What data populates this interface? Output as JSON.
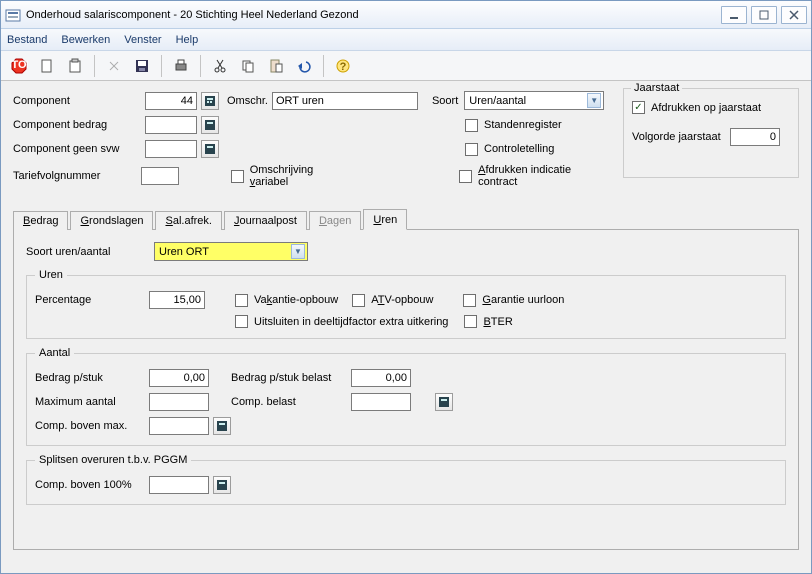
{
  "window": {
    "title": "Onderhoud salariscomponent - 20 Stichting Heel Nederland Gezond"
  },
  "menu": {
    "items": [
      "Bestand",
      "Bewerken",
      "Venster",
      "Help"
    ]
  },
  "form": {
    "component_label": "Component",
    "component_value": "44",
    "omschr_label": "Omschr.",
    "omschr_value": "ORT uren",
    "soort_label": "Soort",
    "soort_value": "Uren/aantal",
    "component_bedrag_label": "Component bedrag",
    "component_bedrag_value": "",
    "component_geen_svw_label": "Component geen svw",
    "component_geen_svw_value": "",
    "tariefvolg_label": "Tariefvolgnummer",
    "tariefvolg_value": "",
    "omschrijving_variabel": "Omschrijving variabel",
    "standenregister": "Standenregister",
    "controletelling": "Controletelling",
    "afdrukken_indicatie": "Afdrukken indicatie contract"
  },
  "jaar": {
    "legend": "Jaarstaat",
    "afdrukken": "Afdrukken op jaarstaat",
    "volgorde_label": "Volgorde jaarstaat",
    "volgorde_value": "0"
  },
  "tabs": {
    "t1": "Bedrag",
    "t2": "Grondslagen",
    "t3": "Sal.afrek.",
    "t4": "Journaalpost",
    "t5": "Dagen",
    "t6": "Uren"
  },
  "uren": {
    "soort_label": "Soort uren/aantal",
    "soort_value": "Uren ORT",
    "group_uren": "Uren",
    "percentage_label": "Percentage",
    "percentage_value": "15,00",
    "vakantie": "Vakantie-opbouw",
    "atv": "ATV-opbouw",
    "garantie": "Garantie uurloon",
    "uitsluiten": "Uitsluiten in deeltijdfactor extra uitkering",
    "bter": "BTER",
    "group_aantal": "Aantal",
    "bedrag_pstuk_label": "Bedrag p/stuk",
    "bedrag_pstuk_value": "0,00",
    "bedrag_pstuk_belast_label": "Bedrag p/stuk belast",
    "bedrag_pstuk_belast_value": "0,00",
    "max_aantal_label": "Maximum aantal",
    "max_aantal_value": "",
    "comp_belast_label": "Comp. belast",
    "comp_belast_value": "",
    "comp_boven_max_label": "Comp. boven max.",
    "comp_boven_max_value": "",
    "group_split": "Splitsen overuren t.b.v. PGGM",
    "comp_boven_100_label": "Comp. boven 100%",
    "comp_boven_100_value": ""
  }
}
